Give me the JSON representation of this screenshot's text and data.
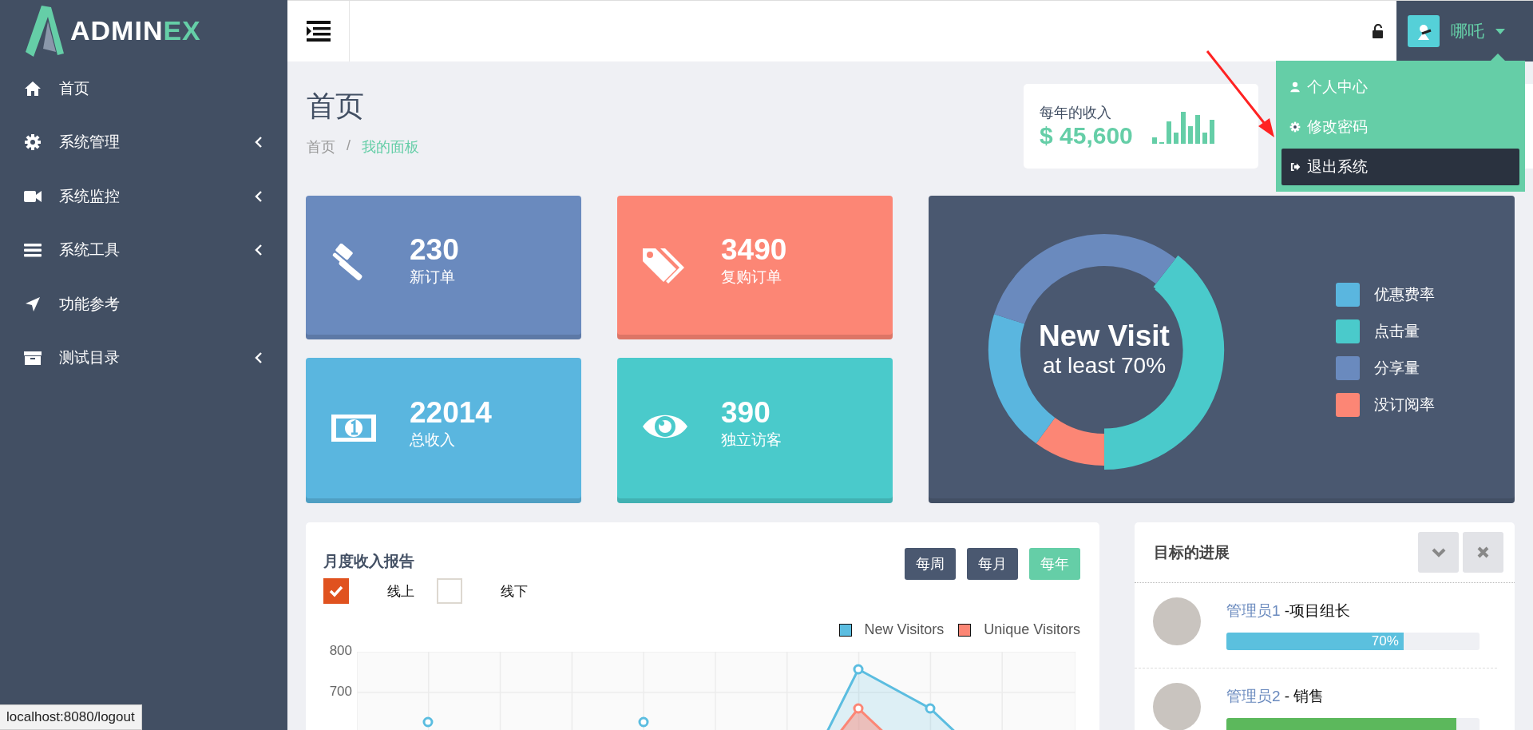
{
  "logo": {
    "text": "ADMIN",
    "accent": "EX"
  },
  "sidebar": {
    "items": [
      {
        "label": "首页",
        "kind": "home",
        "expandable": false
      },
      {
        "label": "系统管理",
        "kind": "gear",
        "expandable": true
      },
      {
        "label": "系统监控",
        "kind": "camera",
        "expandable": true
      },
      {
        "label": "系统工具",
        "kind": "bars",
        "expandable": true
      },
      {
        "label": "功能参考",
        "kind": "arrow",
        "expandable": false
      },
      {
        "label": "测试目录",
        "kind": "archive",
        "expandable": true
      }
    ]
  },
  "topbar": {
    "user": {
      "name": "哪吒"
    },
    "menu": {
      "open": true,
      "items": [
        {
          "label": "个人中心",
          "kind": "user",
          "selected": false
        },
        {
          "label": "修改密码",
          "kind": "gear",
          "selected": false
        },
        {
          "label": "退出系统",
          "kind": "signout",
          "selected": true
        }
      ]
    }
  },
  "page": {
    "title": "首页",
    "breadcrumb": [
      {
        "label": "首页",
        "current": false
      },
      {
        "label": "我的面板",
        "current": true
      }
    ],
    "separator": "/"
  },
  "summary_cards": [
    {
      "label": "每年的收入",
      "value": "$ 45,600"
    }
  ],
  "tiles": [
    {
      "value": "230",
      "label": "新订单",
      "kind": "gavel",
      "color": "#6a8abe"
    },
    {
      "value": "3490",
      "label": "复购订单",
      "kind": "tags",
      "color": "#fc8675"
    },
    {
      "value": "22014",
      "label": "总收入",
      "kind": "money",
      "color": "#5ab6df"
    },
    {
      "value": "390",
      "label": "独立访客",
      "kind": "eye",
      "color": "#4acacb"
    }
  ],
  "donut": {
    "title": "New Visit",
    "subtitle": "at least 70%",
    "legend": [
      {
        "label": "优惠费率",
        "color": "#5ab6df"
      },
      {
        "label": "点击量",
        "color": "#4acacb"
      },
      {
        "label": "分享量",
        "color": "#6a8abe"
      },
      {
        "label": "没订阅率",
        "color": "#fc8675"
      }
    ]
  },
  "revenue_report": {
    "title": "月度收入报告",
    "filters": [
      {
        "label": "线上",
        "checked": true
      },
      {
        "label": "线下",
        "checked": false
      }
    ],
    "periods": [
      {
        "label": "每周",
        "selected": false
      },
      {
        "label": "每月",
        "selected": false
      },
      {
        "label": "每年",
        "selected": true
      }
    ],
    "legend": [
      {
        "label": "New Visitors",
        "color": "#5bbde0"
      },
      {
        "label": "Unique Visitors",
        "color": "#fc8675"
      }
    ],
    "y_axis_labels": [
      "800",
      "700"
    ]
  },
  "goals": {
    "title": "目标的进展",
    "items": [
      {
        "name": "管理员1",
        "role": "-项目组长",
        "level": 0.7,
        "reading": "70%",
        "color": "#5bc0de"
      },
      {
        "name": "管理员2",
        "role": "- 销售",
        "level": 0.91,
        "color": "#5cb85c"
      }
    ]
  },
  "status_bar": {
    "url": "localhost:8080/logout"
  }
}
